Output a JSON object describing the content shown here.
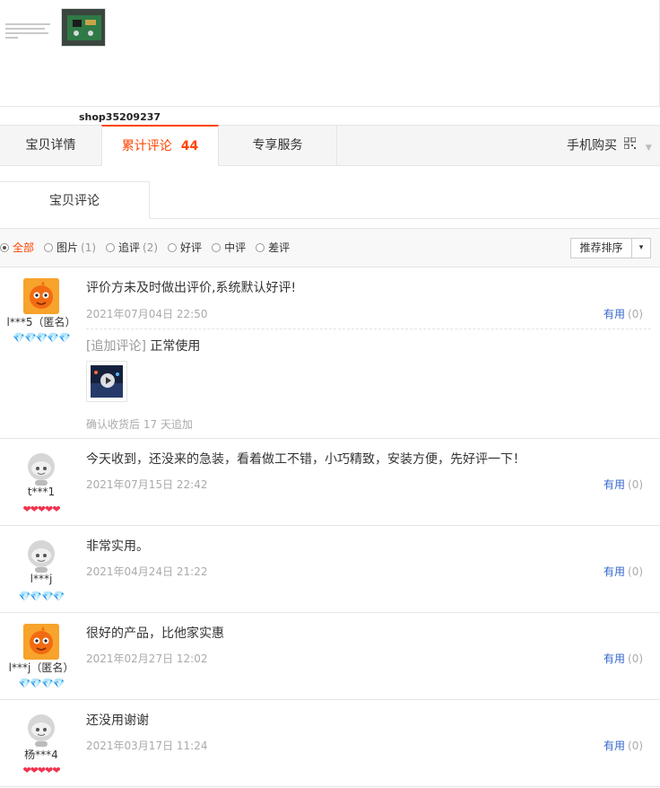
{
  "shop": {
    "name": "shop35209237"
  },
  "tabs": [
    {
      "label": "宝贝详情"
    },
    {
      "label": "累计评论",
      "count": "44"
    },
    {
      "label": "专享服务"
    },
    {
      "label": "手机购买"
    }
  ],
  "subtab": {
    "label": "宝贝评论"
  },
  "filters": [
    {
      "label": "全部",
      "count": ""
    },
    {
      "label": "图片",
      "count": "(1)"
    },
    {
      "label": "追评",
      "count": "(2)"
    },
    {
      "label": "好评",
      "count": ""
    },
    {
      "label": "中评",
      "count": ""
    },
    {
      "label": "差评",
      "count": ""
    }
  ],
  "sort": {
    "label": "推荐排序",
    "arrow": "▾"
  },
  "reviews": [
    {
      "nick": "l***5（匿名）",
      "medals": "💎💎💎💎💎",
      "text": "评价方未及时做出评价,系统默认好评!",
      "date": "2021年07月04日 22:50",
      "useful": "有用",
      "useful_count": "(0)",
      "append_tag": "[追加评论]",
      "append_text": "正常使用",
      "append_note": "确认收货后 17 天追加"
    },
    {
      "nick": "t***1",
      "medals": "❤❤❤❤❤",
      "text": "今天收到，还没来的急装，看着做工不错，小巧精致，安装方便，先好评一下！",
      "date": "2021年07月15日 22:42",
      "useful": "有用",
      "useful_count": "(0)"
    },
    {
      "nick": "l***j",
      "medals": "💎💎💎💎",
      "text": "非常实用。",
      "date": "2021年04月24日 21:22",
      "useful": "有用",
      "useful_count": "(0)"
    },
    {
      "nick": "l***j（匿名）",
      "medals": "💎💎💎💎",
      "text": "很好的产品，比他家实惠",
      "date": "2021年02月27日 12:02",
      "useful": "有用",
      "useful_count": "(0)"
    },
    {
      "nick": "杨***4",
      "medals": "❤❤❤❤❤",
      "text": "还没用谢谢",
      "date": "2021年03月17日 11:24",
      "useful": "有用",
      "useful_count": "(0)"
    }
  ],
  "colors": {
    "accent": "#ff4400",
    "link": "#3366cc",
    "muted": "#aaaaaa",
    "border": "#e5e5e5"
  },
  "icons": {
    "qr": "qr-code-icon",
    "play": "play-icon",
    "blue_medal": "diamond-icon",
    "red_medal": "heart-icon"
  }
}
